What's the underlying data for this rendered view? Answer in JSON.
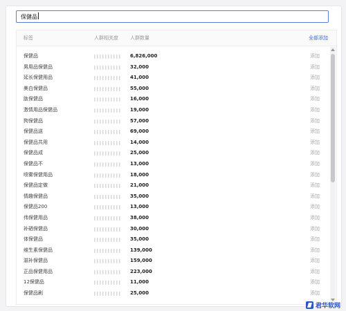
{
  "search": {
    "value": "保健品"
  },
  "table": {
    "headers": {
      "label": "标签",
      "relevance": "人群相关度",
      "count": "人群数量",
      "add_all": "全部添加"
    },
    "add_label": "添加",
    "rows": [
      {
        "label": "保健品",
        "count": "6,826,000"
      },
      {
        "label": "男用品保健品",
        "count": "32,000"
      },
      {
        "label": "延长保健用品",
        "count": "41,000"
      },
      {
        "label": "美白保健品",
        "count": "55,000"
      },
      {
        "label": "肽保健品",
        "count": "16,000"
      },
      {
        "label": "激情用品保健品",
        "count": "19,000"
      },
      {
        "label": "狗保健品",
        "count": "57,000"
      },
      {
        "label": "保健品送",
        "count": "69,000"
      },
      {
        "label": "保健品共用",
        "count": "14,000"
      },
      {
        "label": "保健品成",
        "count": "25,000"
      },
      {
        "label": "保健品不",
        "count": "13,000"
      },
      {
        "label": "喷雾保健用品",
        "count": "18,000"
      },
      {
        "label": "保健品定做",
        "count": "21,000"
      },
      {
        "label": "情趣保健品",
        "count": "35,000"
      },
      {
        "label": "保健品200",
        "count": "13,000"
      },
      {
        "label": "伟保健用品",
        "count": "38,000"
      },
      {
        "label": "补硒保健品",
        "count": "30,000"
      },
      {
        "label": "体保健品",
        "count": "35,000"
      },
      {
        "label": "维生素保健品",
        "count": "139,000"
      },
      {
        "label": "滋补保健品",
        "count": "159,000"
      },
      {
        "label": "正品保健用品",
        "count": "223,000"
      },
      {
        "label": "12保健品",
        "count": "11,000"
      },
      {
        "label": "保健品刷",
        "count": "25,000"
      }
    ]
  },
  "watermark": {
    "text": "君华软网"
  }
}
